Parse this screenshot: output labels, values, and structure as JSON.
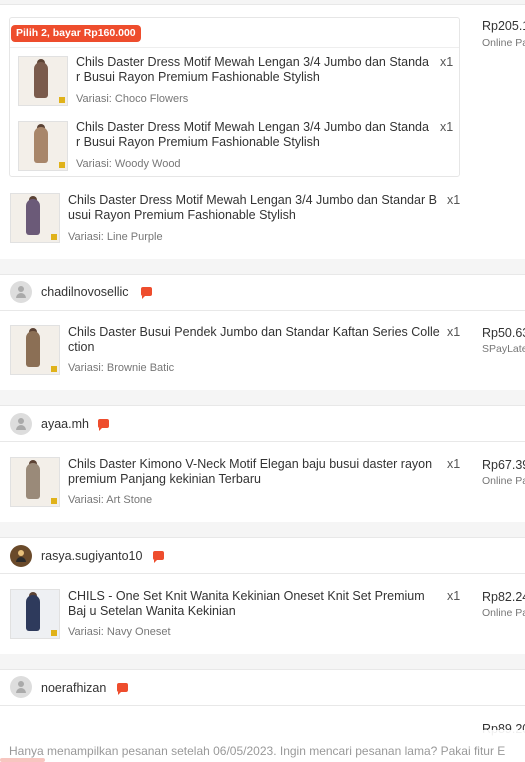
{
  "colors": {
    "accent": "#ee4d2d",
    "promo_bg": "#ee4d2d",
    "page_bg": "#f5f5f5"
  },
  "order1": {
    "promo_label": "Pilih 2, bayar Rp160.000",
    "price": "Rp205.1",
    "payment": "Online Pa",
    "items": [
      {
        "name": "Chils Daster Dress Motif Mewah Lengan 3/4 Jumbo dan Standa r Busui Rayon Premium Fashionable Stylish",
        "qty": "x1",
        "variant": "Variasi: Choco Flowers"
      },
      {
        "name": "Chils Daster Dress Motif Mewah Lengan 3/4 Jumbo dan Standa r Busui Rayon Premium Fashionable Stylish",
        "qty": "x1",
        "variant": "Variasi: Woody Wood"
      },
      {
        "name": "Chils Daster Dress Motif Mewah Lengan 3/4 Jumbo dan Standar B usui Rayon Premium Fashionable Stylish",
        "qty": "x1",
        "variant": "Variasi: Line Purple"
      }
    ]
  },
  "orders": [
    {
      "seller": "chadilnovosellic",
      "item": {
        "name": "Chils Daster Busui Pendek Jumbo dan Standar Kaftan Series Colle ction",
        "qty": "x1",
        "variant": "Variasi: Brownie Batic"
      },
      "price": "Rp50.63",
      "payment": "SPayLate"
    },
    {
      "seller": "ayaa.mh",
      "item": {
        "name": "Chils Daster Kimono V-Neck Motif Elegan baju busui daster rayon premium Panjang kekinian Terbaru",
        "qty": "x1",
        "variant": "Variasi: Art Stone"
      },
      "price": "Rp67.39",
      "payment": "Online Pa"
    },
    {
      "seller": "rasya.sugiyanto10",
      "item": {
        "name": "CHILS - One Set Knit Wanita Kekinian Oneset Knit Set Premium Baj u Setelan Wanita Kekinian",
        "qty": "x1",
        "variant": "Variasi: Navy Oneset"
      },
      "price": "Rp82.24",
      "payment": "Online Pa"
    }
  ],
  "next_seller": "noerafhizan",
  "partial_price": "Rp89.20",
  "footer_note": "Hanya menampilkan pesanan setelah 06/05/2023. Ingin mencari pesanan lama? Pakai fitur E"
}
